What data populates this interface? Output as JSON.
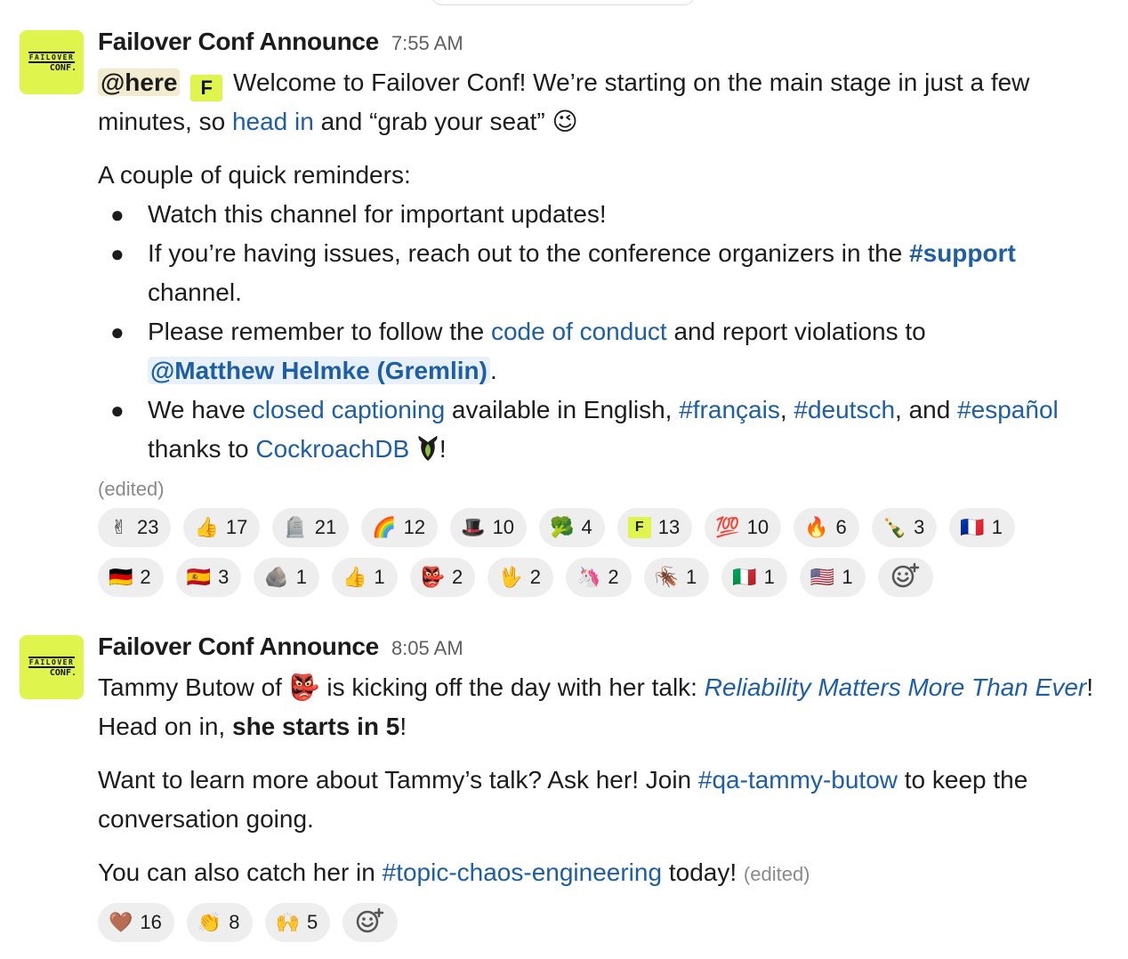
{
  "messages": [
    {
      "author": "Failover Conf Announce",
      "time": "7:55 AM",
      "avatar": {
        "line1": "FAILOVER",
        "line2": "CONF."
      },
      "mention_here": "@here",
      "f_emoji": "F",
      "intro_1": "Welcome to Failover Conf! We’re starting on the main stage in just a few minutes, so ",
      "intro_link": "head in",
      "intro_2": " and “grab your seat” ",
      "wink_emoji": "😉",
      "reminders_title": "A couple of quick reminders:",
      "bullets": {
        "b1": "Watch this channel for important updates!",
        "b2_pre": "If you’re having issues, reach out to the conference organizers in the ",
        "b2_channel": "#support",
        "b2_post": " channel.",
        "b3_pre": "Please remember to follow the ",
        "b3_link": "code of conduct",
        "b3_mid": " and report violations to ",
        "b3_mention": "@Matthew Helmke (Gremlin)",
        "b3_post": ".",
        "b4_pre": "We have ",
        "b4_link": "closed captioning",
        "b4_mid": " available in English, ",
        "b4_ch1": "#français",
        "b4_sep1": ", ",
        "b4_ch2": "#deutsch",
        "b4_sep2": ", and ",
        "b4_ch3": "#español",
        "b4_thanks": " thanks to ",
        "b4_link2": "CockroachDB",
        "b4_end": "!"
      },
      "edited": "(edited)",
      "reactions": [
        {
          "emoji": "✌",
          "count": "23"
        },
        {
          "emoji": "👍",
          "count": "17"
        },
        {
          "emoji": "🪦",
          "count": "21"
        },
        {
          "emoji": "🌈",
          "count": "12"
        },
        {
          "emoji": "🎩",
          "count": "10"
        },
        {
          "emoji": "🥦",
          "count": "4"
        },
        {
          "emoji": "F",
          "count": "13",
          "type": "f"
        },
        {
          "emoji": "💯",
          "count": "10"
        },
        {
          "emoji": "🔥",
          "count": "6"
        },
        {
          "emoji": "🍾",
          "count": "3"
        },
        {
          "emoji": "🇫🇷",
          "count": "1"
        },
        {
          "emoji": "🇩🇪",
          "count": "2"
        },
        {
          "emoji": "🇪🇸",
          "count": "3"
        },
        {
          "emoji": "🪨",
          "count": "1"
        },
        {
          "emoji": "👍",
          "count": "1"
        },
        {
          "emoji": "👺",
          "count": "2"
        },
        {
          "emoji": "🖖",
          "count": "2"
        },
        {
          "emoji": "🦄",
          "count": "2"
        },
        {
          "emoji": "🪳",
          "count": "1"
        },
        {
          "emoji": "🇮🇹",
          "count": "1"
        },
        {
          "emoji": "🇺🇸",
          "count": "1"
        }
      ]
    },
    {
      "author": "Failover Conf Announce",
      "time": "8:05 AM",
      "avatar": {
        "line1": "FAILOVER",
        "line2": "CONF."
      },
      "p1_pre": "Tammy Butow of ",
      "p1_emoji": "👺",
      "p1_mid": " is kicking off the day with her talk: ",
      "p1_link": "Reliability Matters More Than Ever",
      "p1_mid2": "! Head on in, ",
      "p1_bold": "she starts in 5",
      "p1_end": "!",
      "p2_pre": "Want to learn more about Tammy’s talk? Ask her! Join ",
      "p2_channel": "#qa-tammy-butow",
      "p2_post": " to keep the conversation going.",
      "p3_pre": "You can also catch her in ",
      "p3_channel": "#topic-chaos-engineering",
      "p3_post": " today! ",
      "edited": "(edited)",
      "reactions": [
        {
          "emoji": "🤎",
          "count": "16"
        },
        {
          "emoji": "👏",
          "count": "8"
        },
        {
          "emoji": "🙌",
          "count": "5"
        }
      ]
    }
  ],
  "colors": {
    "accent_link": "#1d5ea5",
    "brand_yellow": "#dff44c",
    "reaction_bg": "#eeeeee"
  },
  "icons": {
    "add_reaction": "add-reaction-icon",
    "cockroach": "cockroach-icon"
  }
}
